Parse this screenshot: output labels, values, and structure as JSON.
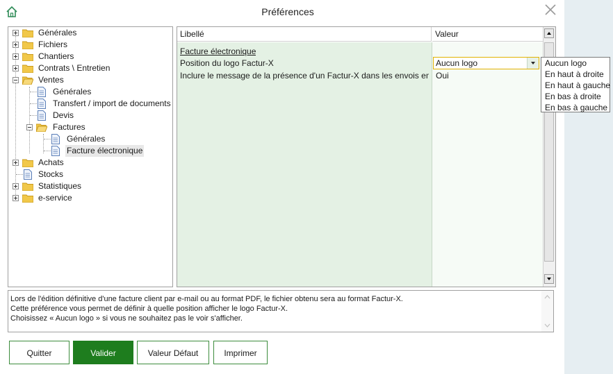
{
  "window": {
    "title": "Préférences"
  },
  "tree": {
    "items": [
      {
        "label": "Générales"
      },
      {
        "label": "Fichiers"
      },
      {
        "label": "Chantiers"
      },
      {
        "label": "Contrats \\ Entretien"
      },
      {
        "label": "Ventes"
      },
      {
        "label": "Générales"
      },
      {
        "label": "Transfert / import de documents"
      },
      {
        "label": "Devis"
      },
      {
        "label": "Factures"
      },
      {
        "label": "Générales"
      },
      {
        "label": "Facture électronique"
      },
      {
        "label": "Achats"
      },
      {
        "label": "Stocks"
      },
      {
        "label": "Statistiques"
      },
      {
        "label": "e-service"
      }
    ]
  },
  "grid": {
    "headers": {
      "libelle": "Libellé",
      "valeur": "Valeur"
    },
    "section": "Facture électronique",
    "rows": [
      {
        "label": "Position du logo Factur-X",
        "value": "Aucun logo"
      },
      {
        "label": "Inclure le message de la présence d'un Factur-X dans les envois em...",
        "value": "Oui"
      }
    ]
  },
  "dropdown": {
    "options": [
      "Aucun logo",
      "En haut à droite",
      "En haut à gauche",
      "En bas à droite",
      "En bas à gauche"
    ]
  },
  "description": {
    "lines": [
      "Lors de l'édition définitive d'une facture client par e-mail ou au format PDF, le fichier obtenu sera au format Factur-X.",
      "Cette préférence vous permet de définir à quelle position afficher le logo Factur-X.",
      "Choisissez « Aucun logo » si vous ne souhaitez pas le voir s'afficher."
    ]
  },
  "buttons": {
    "quit": "Quitter",
    "validate": "Valider",
    "default": "Valeur Défaut",
    "print": "Imprimer"
  },
  "colors": {
    "accent": "#1e7d1e",
    "label_column": "#e4f1e4",
    "combo_border": "#e1b200"
  }
}
